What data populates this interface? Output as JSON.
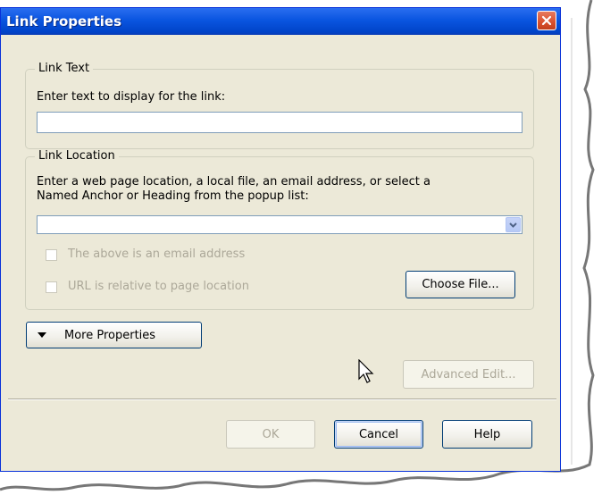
{
  "dialog": {
    "title": "Link Properties",
    "close_icon": "close-icon"
  },
  "link_text": {
    "legend": "Link Text",
    "prompt": "Enter text to display for the link:",
    "value": ""
  },
  "link_location": {
    "legend": "Link Location",
    "prompt_line1": "Enter a web page location, a local file, an email address, or select a",
    "prompt_line2": "Named Anchor or Heading from the popup list:",
    "value": "",
    "email_checkbox_label": "The above is an email address",
    "relative_checkbox_label": "URL is relative to page location",
    "choose_file_label": "Choose File..."
  },
  "more_properties_label": "More Properties",
  "advanced_edit_label": "Advanced Edit...",
  "buttons": {
    "ok": "OK",
    "cancel": "Cancel",
    "help": "Help"
  },
  "colors": {
    "titlebar": "#0a55e0",
    "dialog_bg": "#ece9d8",
    "close": "#d9502d"
  }
}
